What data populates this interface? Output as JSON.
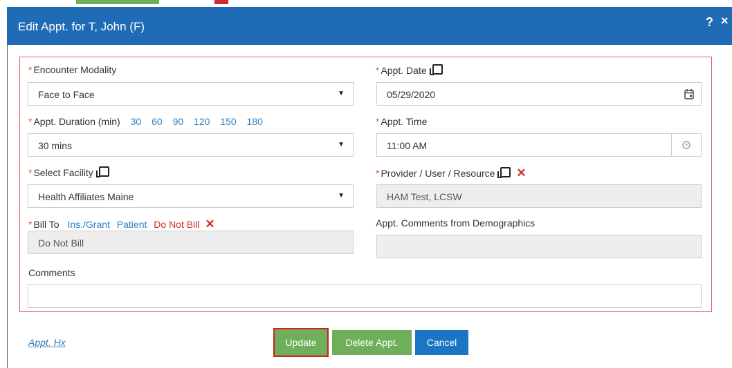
{
  "dialog": {
    "title": "Edit Appt. for T, John (F)",
    "help": "?",
    "close": "×"
  },
  "form": {
    "required_mark": "*",
    "encounter_modality": {
      "label": "Encounter Modality",
      "value": "Face to Face"
    },
    "appt_date": {
      "label": "Appt. Date",
      "value": "05/29/2020"
    },
    "appt_duration": {
      "label": "Appt. Duration (min)",
      "options": [
        "30",
        "60",
        "90",
        "120",
        "150",
        "180"
      ],
      "value": "30 mins"
    },
    "appt_time": {
      "label": "Appt. Time",
      "value": "11:00 AM"
    },
    "facility": {
      "label": "Select Facility",
      "value": "Health Affiliates Maine"
    },
    "provider": {
      "label": "Provider / User / Resource",
      "value": "HAM Test, LCSW"
    },
    "bill_to": {
      "label": "Bill To",
      "opt_ins": "Ins./Grant",
      "opt_patient": "Patient",
      "opt_dnb": "Do Not Bill",
      "value": "Do Not Bill"
    },
    "demographic_comments": {
      "label": "Appt. Comments from Demographics",
      "value": ""
    },
    "comments": {
      "label": "Comments",
      "value": ""
    }
  },
  "footer": {
    "history_link": "Appt. Hx",
    "update": "Update",
    "delete": "Delete Appt.",
    "cancel": "Cancel"
  },
  "colors": {
    "header_bg": "#1f6bb5",
    "green_button": "#6fae5b",
    "blue_button": "#1b74c4",
    "required_red": "#d9534f",
    "link_blue": "#2d7fc1"
  },
  "icons": {
    "date_picker": "calendar-icon",
    "time_picker": "clock-icon",
    "copy": "copy-icon",
    "remove": "x-icon"
  }
}
